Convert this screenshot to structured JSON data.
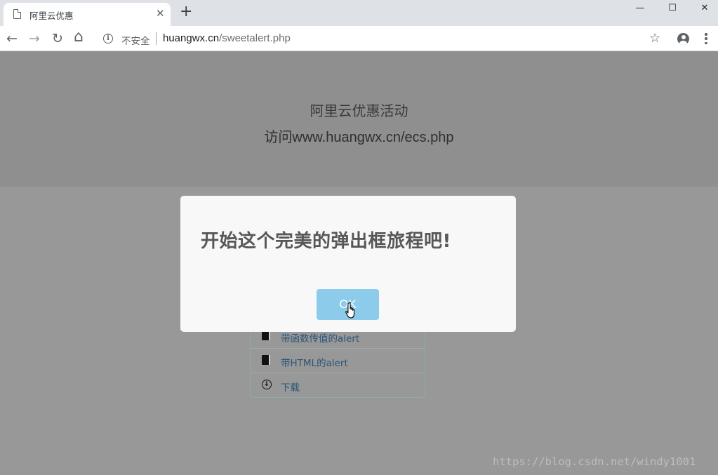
{
  "browser": {
    "tab_title": "阿里云优惠",
    "tab_close": "✕",
    "new_tab": "+",
    "window_controls": {
      "minimize": "—",
      "maximize": "☐",
      "close": "✕"
    },
    "nav": {
      "back": "←",
      "forward": "→",
      "reload": "↻",
      "home": "⌂"
    },
    "security_label": "不安全",
    "url_host": "huangwx.cn",
    "url_path": "/sweetalert.php",
    "bookmark_star": "☆"
  },
  "page": {
    "banner_line1": "阿里云优惠活动",
    "banner_line2": "访问www.huangwx.cn/ecs.php",
    "list_items": [
      {
        "icon": "book-icon",
        "label": "带函数传值的alert"
      },
      {
        "icon": "book-icon",
        "label": "带HTML的alert"
      },
      {
        "icon": "download-icon",
        "label": "下载"
      }
    ]
  },
  "modal": {
    "title": "开始这个完美的弹出框旅程吧!",
    "ok_label": "OK"
  },
  "watermark": "https://blog.csdn.net/windy1001",
  "colors": {
    "overlay": "#989898",
    "banner": "#8f8f8f",
    "modal_bg": "#f8f8f8",
    "ok_button": "#8cccea",
    "link_text": "#2a5578"
  }
}
